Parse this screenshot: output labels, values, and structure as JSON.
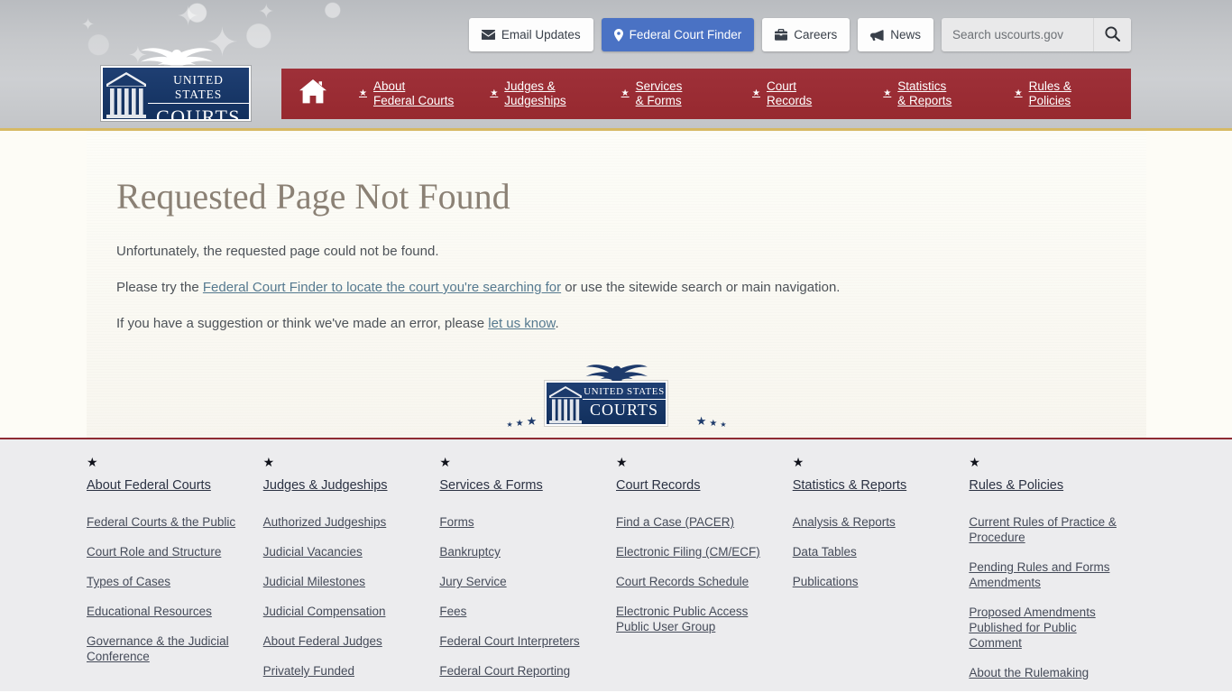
{
  "header": {
    "logo": {
      "line1": "UNITED STATES",
      "line2": "COURTS",
      "alt": "United States Courts"
    },
    "utility": [
      {
        "label": "Email Updates",
        "icon": "envelope-icon"
      },
      {
        "label": "Federal Court Finder",
        "icon": "map-pin-icon",
        "active": true
      },
      {
        "label": "Careers",
        "icon": "briefcase-icon"
      },
      {
        "label": "News",
        "icon": "megaphone-icon"
      }
    ],
    "search": {
      "placeholder": "Search uscourts.gov",
      "value": "",
      "button_icon": "search-icon"
    },
    "nav": {
      "home_icon": "home-icon",
      "items": [
        {
          "line1": "About",
          "line2": "Federal Courts"
        },
        {
          "line1": "Judges &",
          "line2": "Judgeships"
        },
        {
          "line1": "Services",
          "line2": "& Forms"
        },
        {
          "line1": "Court",
          "line2": "Records"
        },
        {
          "line1": "Statistics",
          "line2": "& Reports"
        },
        {
          "line1": "Rules &",
          "line2": "Policies"
        }
      ]
    }
  },
  "main": {
    "title": "Requested Page Not Found",
    "p1": "Unfortunately, the requested page could not be found.",
    "p2_pre": "Please try the ",
    "p2_link": "Federal Court Finder to locate the court you're searching for",
    "p2_post": " or use the sitewide search or main navigation.",
    "p3_pre": "If you have a suggestion or think we've made an error, please ",
    "p3_link": "let us know",
    "p3_post": ".",
    "seal": {
      "line1": "UNITED STATES",
      "line2": "COURTS"
    }
  },
  "footer": {
    "columns": [
      {
        "heading": "About Federal Courts",
        "links": [
          "Federal Courts & the Public",
          "Court Role and Structure",
          "Types of Cases",
          "Educational Resources",
          "Governance & the Judicial Conference"
        ]
      },
      {
        "heading": "Judges & Judgeships",
        "links": [
          "Authorized Judgeships",
          "Judicial Vacancies",
          "Judicial Milestones",
          "Judicial Compensation",
          "About Federal Judges",
          "Privately Funded"
        ]
      },
      {
        "heading": "Services & Forms",
        "links": [
          "Forms",
          "Bankruptcy",
          "Jury Service",
          "Fees",
          "Federal Court Interpreters",
          "Federal Court Reporting"
        ]
      },
      {
        "heading": "Court Records",
        "links": [
          "Find a Case (PACER)",
          "Electronic Filing (CM/ECF)",
          "Court Records Schedule",
          "Electronic Public Access Public User Group"
        ]
      },
      {
        "heading": "Statistics & Reports",
        "links": [
          "Analysis & Reports",
          "Data Tables",
          "Publications"
        ]
      },
      {
        "heading": "Rules & Policies",
        "links": [
          "Current Rules of Practice & Procedure",
          "Pending Rules and Forms Amendments",
          "Proposed Amendments Published for Public Comment",
          "About the Rulemaking"
        ]
      }
    ],
    "star_glyph": "★"
  },
  "colors": {
    "nav_red": "#97292f",
    "accent_blue": "#4a72c4",
    "gold_border": "#d6b964",
    "heading_brown": "#8b8175",
    "link_blue": "#55798f",
    "logo_navy": "#12305d"
  }
}
